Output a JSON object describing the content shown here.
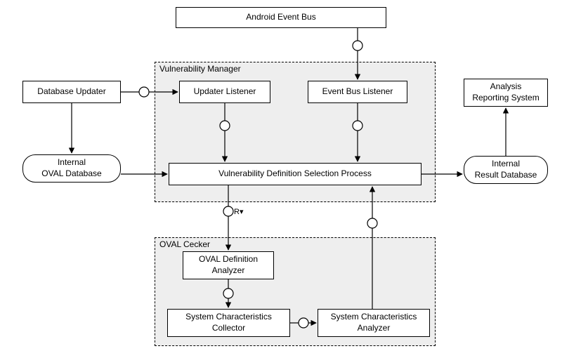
{
  "nodes": {
    "android_event_bus": "Android Event Bus",
    "database_updater": "Database Updater",
    "internal_oval_db": "Internal\nOVAL Database",
    "analysis_reporting": "Analysis\nReporting System",
    "internal_result_db": "Internal\nResult Database",
    "updater_listener": "Updater Listener",
    "event_bus_listener": "Event Bus Listener",
    "vuln_def_sel": "Vulnerability Definition Selection Process",
    "oval_def_analyzer": "OVAL Definition\nAnalyzer",
    "sys_char_collector": "System Characteristics\nCollector",
    "sys_char_analyzer": "System Characteristics\nAnalyzer"
  },
  "groups": {
    "vuln_manager": "Vulnerability Manager",
    "oval_checker": "OVAL Cecker"
  },
  "labels": {
    "rv": "R▾"
  }
}
